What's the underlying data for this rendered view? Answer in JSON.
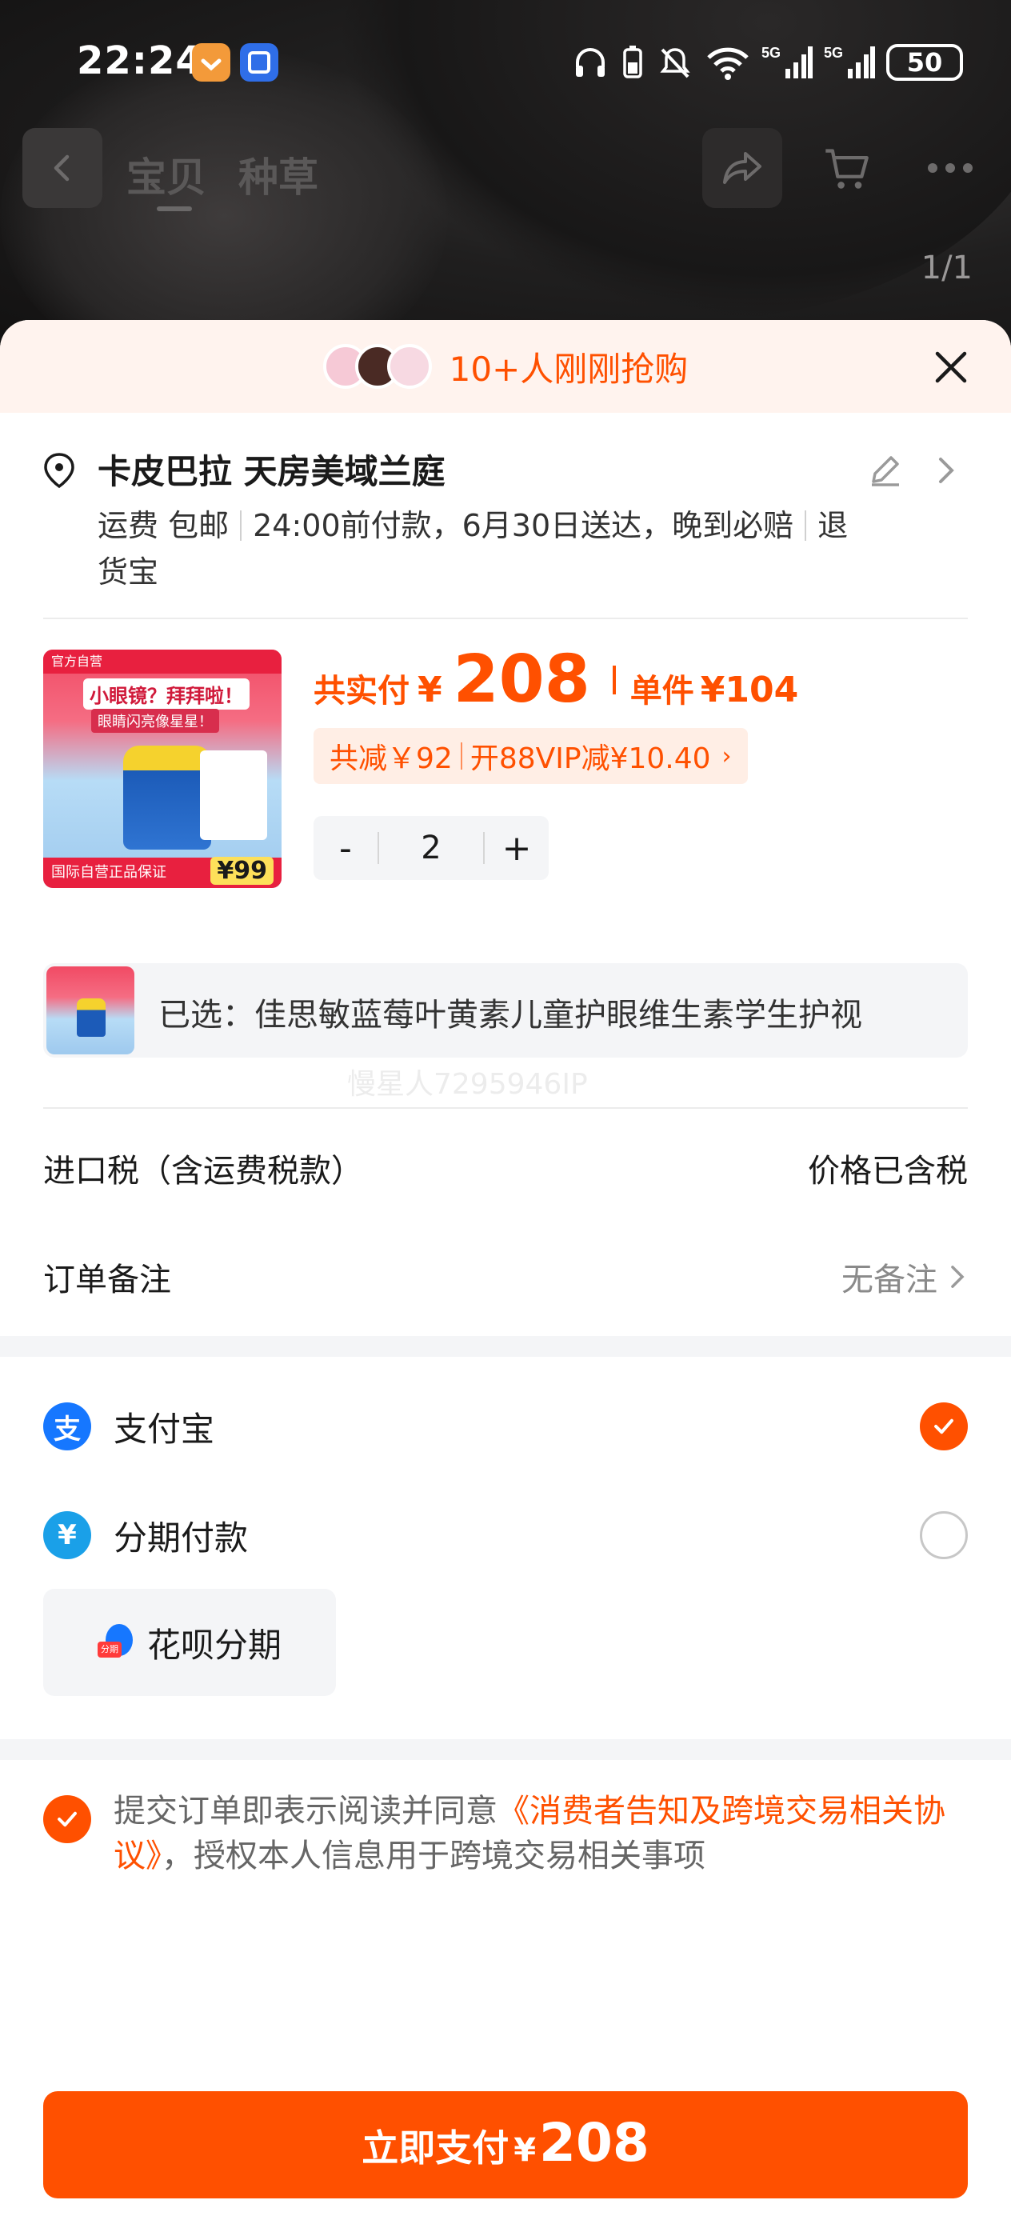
{
  "status_bar": {
    "time": "22:24",
    "battery": "50",
    "icons": [
      "headphones-icon",
      "battery-small-icon",
      "mute-icon",
      "wifi-icon",
      "signal-5g-icon",
      "signal-5g-icon"
    ]
  },
  "nav": {
    "tabs": [
      "宝贝",
      "种草"
    ],
    "page_indicator": "1/1",
    "icons": [
      "back-icon",
      "share-icon",
      "cart-icon",
      "more-icon"
    ]
  },
  "banner": {
    "text": "10+人刚刚抢购"
  },
  "address": {
    "title": "卡皮巴拉 天房美域兰庭",
    "shipping_label": "运费",
    "shipping_value": "包邮",
    "delivery": "24:00前付款，6月30日送达，晚到必赔",
    "return_tag_1": "退",
    "return_tag_2": "货宝"
  },
  "product": {
    "image_texts": {
      "top": "官方自营",
      "headline": "小眼镜？拜拜啦！",
      "sub": "眼睛闪亮像星星！",
      "footer": "国际自营正品保证",
      "price": "¥99"
    },
    "total_label": "共实付",
    "currency": "¥",
    "total_amount": "208",
    "unit_label": "单件",
    "unit_price": "¥104",
    "discount_total": "共减￥92",
    "discount_vip": "开88VIP减¥10.40",
    "quantity": "2",
    "minus": "-",
    "plus": "+",
    "selected": "已选：佳思敏蓝莓叶黄素儿童护眼维生素学生护视",
    "watermark": "慢星人7295946IP"
  },
  "rows": {
    "import_tax_label": "进口税（含运费税款）",
    "import_tax_value": "价格已含税",
    "remark_label": "订单备注",
    "remark_value": "无备注"
  },
  "payment": {
    "alipay": "支付宝",
    "installment": "分期付款",
    "huabei": "花呗分期",
    "alipay_checked": true,
    "installment_checked": false
  },
  "agreement": {
    "prefix": "提交订单即表示阅读并同意",
    "link": "《消费者告知及跨境交易相关协议》",
    "suffix": "，授权本人信息用于跨境交易相关事项"
  },
  "pay_button": {
    "label": "立即支付",
    "currency": "¥",
    "amount": "208"
  },
  "colors": {
    "accent": "#ff5000",
    "alipay_blue": "#1677ff",
    "surface": "#f4f5f7"
  }
}
